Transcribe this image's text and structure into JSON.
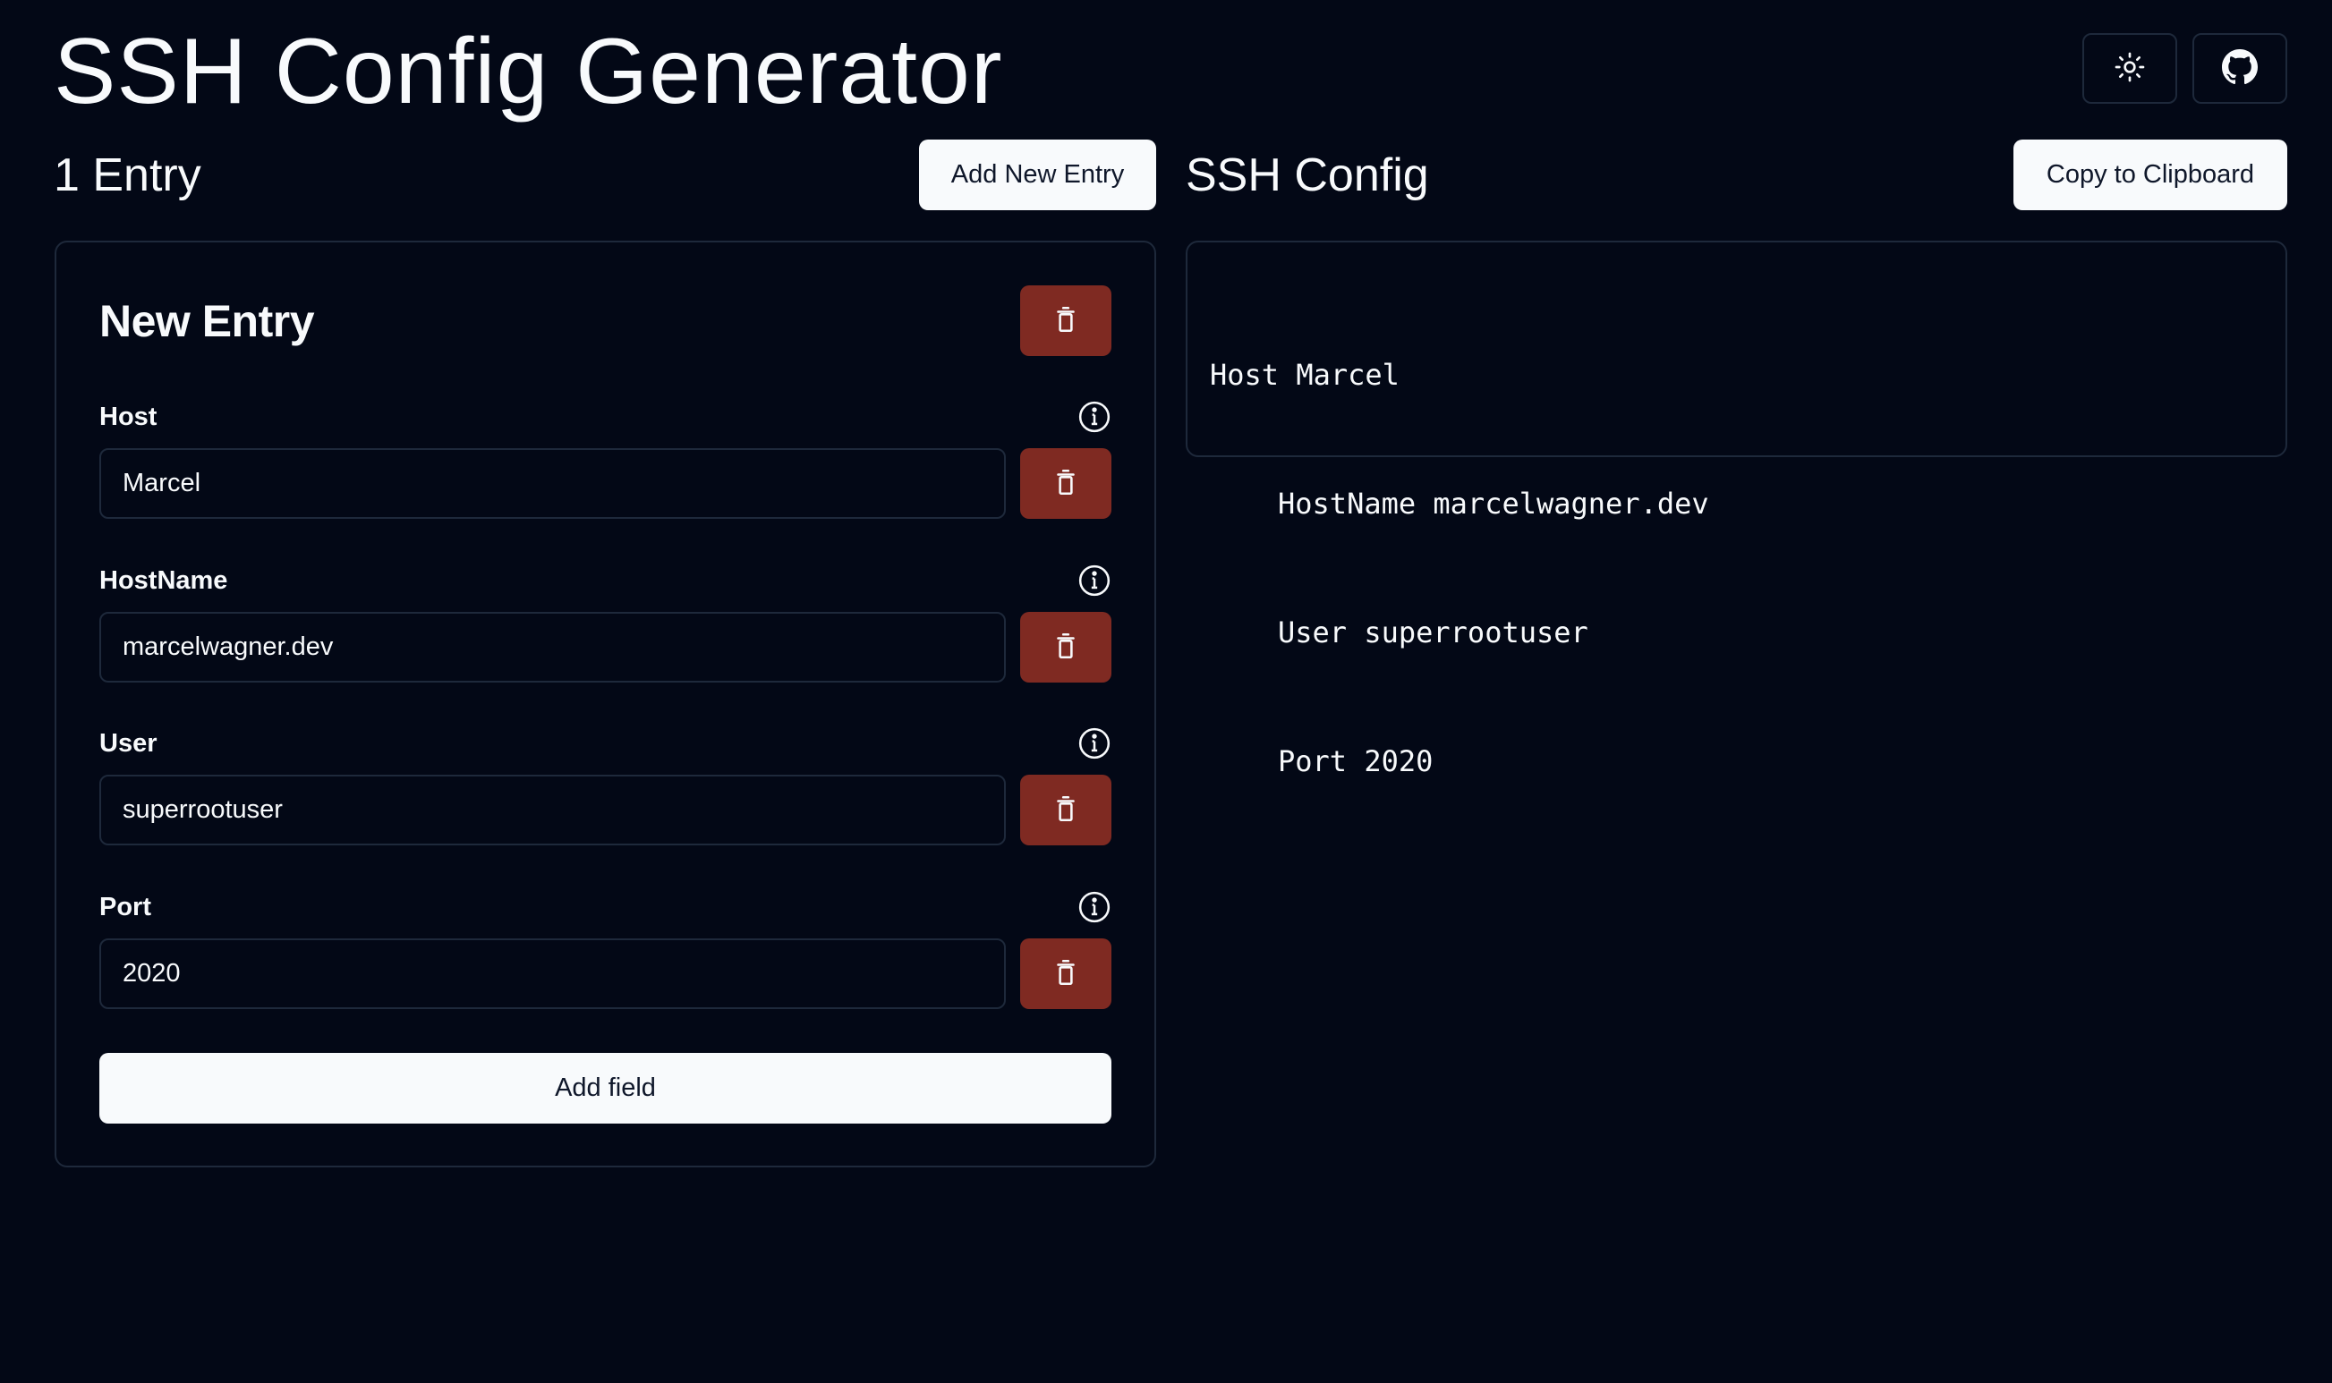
{
  "header": {
    "title": "SSH Config Generator",
    "theme_toggle_icon": "sun-icon",
    "github_icon": "github-icon"
  },
  "entries_panel": {
    "count_label": "1 Entry",
    "add_entry_label": "Add New Entry",
    "entries": [
      {
        "title": "New Entry",
        "fields": [
          {
            "label": "Host",
            "value": "Marcel"
          },
          {
            "label": "HostName",
            "value": "marcelwagner.dev"
          },
          {
            "label": "User",
            "value": "superrootuser"
          },
          {
            "label": "Port",
            "value": "2020"
          }
        ],
        "add_field_label": "Add field"
      }
    ]
  },
  "config_panel": {
    "title": "SSH Config",
    "copy_label": "Copy to Clipboard",
    "lines": [
      {
        "text": "Host Marcel",
        "indent": false
      },
      {
        "text": "HostName marcelwagner.dev",
        "indent": true
      },
      {
        "text": "User superrootuser",
        "indent": true
      },
      {
        "text": "Port 2020",
        "indent": true
      }
    ]
  },
  "colors": {
    "background": "#030816",
    "border": "#1e293b",
    "danger": "#7f2a22",
    "light_button": "#f8fafc",
    "text": "#f8fafc"
  }
}
